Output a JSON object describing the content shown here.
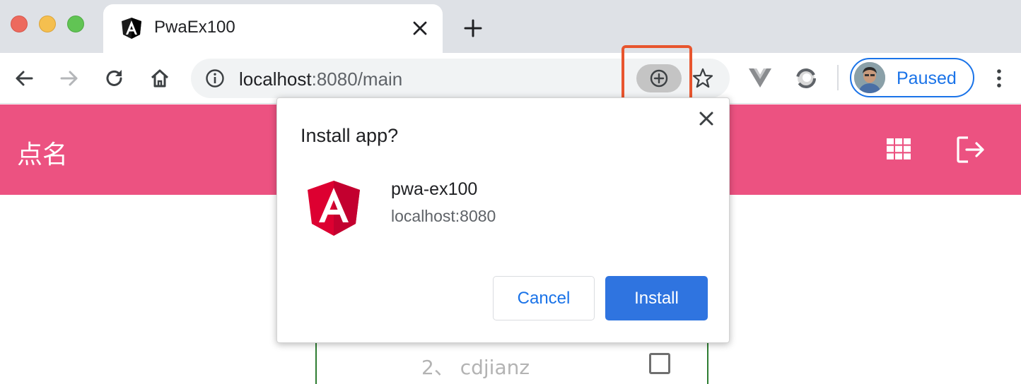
{
  "window": {
    "tab": {
      "title": "PwaEx100",
      "favicon": "angular-icon"
    }
  },
  "toolbar": {
    "url_host": "localhost",
    "url_rest": ":8080/main",
    "install_icon": "install-app-icon",
    "profile_label": "Paused"
  },
  "app": {
    "title": "点名",
    "icons": [
      "apps-grid-icon",
      "logout-icon"
    ],
    "header_color": "#ec5281"
  },
  "list": {
    "item_text": "2、 cdjianz"
  },
  "dialog": {
    "title": "Install app?",
    "app_name": "pwa-ex100",
    "app_origin": "localhost:8080",
    "cancel_label": "Cancel",
    "install_label": "Install",
    "accent": "#2f74e0"
  }
}
